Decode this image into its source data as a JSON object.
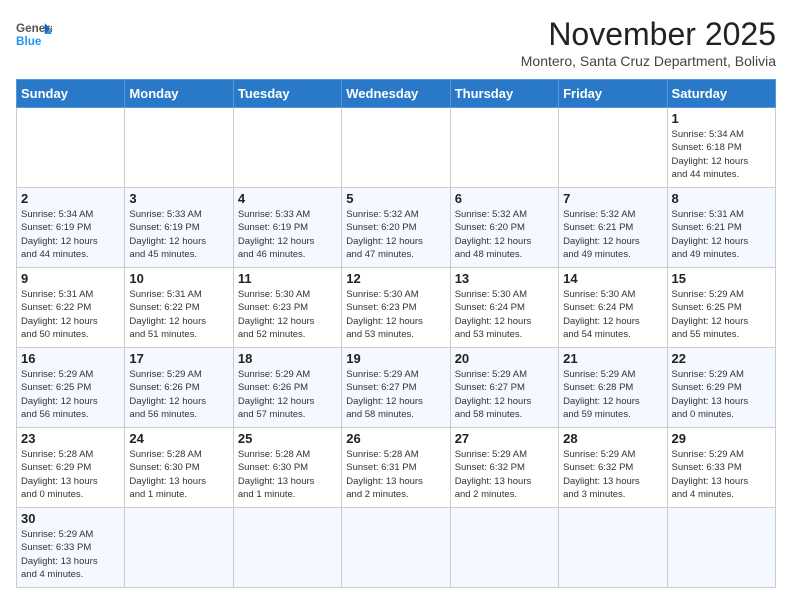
{
  "header": {
    "logo_general": "General",
    "logo_blue": "Blue",
    "month_title": "November 2025",
    "location": "Montero, Santa Cruz Department, Bolivia"
  },
  "weekdays": [
    "Sunday",
    "Monday",
    "Tuesday",
    "Wednesday",
    "Thursday",
    "Friday",
    "Saturday"
  ],
  "weeks": [
    [
      {
        "day": "",
        "info": ""
      },
      {
        "day": "",
        "info": ""
      },
      {
        "day": "",
        "info": ""
      },
      {
        "day": "",
        "info": ""
      },
      {
        "day": "",
        "info": ""
      },
      {
        "day": "",
        "info": ""
      },
      {
        "day": "1",
        "info": "Sunrise: 5:34 AM\nSunset: 6:18 PM\nDaylight: 12 hours\nand 44 minutes."
      }
    ],
    [
      {
        "day": "2",
        "info": "Sunrise: 5:34 AM\nSunset: 6:19 PM\nDaylight: 12 hours\nand 44 minutes."
      },
      {
        "day": "3",
        "info": "Sunrise: 5:33 AM\nSunset: 6:19 PM\nDaylight: 12 hours\nand 45 minutes."
      },
      {
        "day": "4",
        "info": "Sunrise: 5:33 AM\nSunset: 6:19 PM\nDaylight: 12 hours\nand 46 minutes."
      },
      {
        "day": "5",
        "info": "Sunrise: 5:32 AM\nSunset: 6:20 PM\nDaylight: 12 hours\nand 47 minutes."
      },
      {
        "day": "6",
        "info": "Sunrise: 5:32 AM\nSunset: 6:20 PM\nDaylight: 12 hours\nand 48 minutes."
      },
      {
        "day": "7",
        "info": "Sunrise: 5:32 AM\nSunset: 6:21 PM\nDaylight: 12 hours\nand 49 minutes."
      },
      {
        "day": "8",
        "info": "Sunrise: 5:31 AM\nSunset: 6:21 PM\nDaylight: 12 hours\nand 49 minutes."
      }
    ],
    [
      {
        "day": "9",
        "info": "Sunrise: 5:31 AM\nSunset: 6:22 PM\nDaylight: 12 hours\nand 50 minutes."
      },
      {
        "day": "10",
        "info": "Sunrise: 5:31 AM\nSunset: 6:22 PM\nDaylight: 12 hours\nand 51 minutes."
      },
      {
        "day": "11",
        "info": "Sunrise: 5:30 AM\nSunset: 6:23 PM\nDaylight: 12 hours\nand 52 minutes."
      },
      {
        "day": "12",
        "info": "Sunrise: 5:30 AM\nSunset: 6:23 PM\nDaylight: 12 hours\nand 53 minutes."
      },
      {
        "day": "13",
        "info": "Sunrise: 5:30 AM\nSunset: 6:24 PM\nDaylight: 12 hours\nand 53 minutes."
      },
      {
        "day": "14",
        "info": "Sunrise: 5:30 AM\nSunset: 6:24 PM\nDaylight: 12 hours\nand 54 minutes."
      },
      {
        "day": "15",
        "info": "Sunrise: 5:29 AM\nSunset: 6:25 PM\nDaylight: 12 hours\nand 55 minutes."
      }
    ],
    [
      {
        "day": "16",
        "info": "Sunrise: 5:29 AM\nSunset: 6:25 PM\nDaylight: 12 hours\nand 56 minutes."
      },
      {
        "day": "17",
        "info": "Sunrise: 5:29 AM\nSunset: 6:26 PM\nDaylight: 12 hours\nand 56 minutes."
      },
      {
        "day": "18",
        "info": "Sunrise: 5:29 AM\nSunset: 6:26 PM\nDaylight: 12 hours\nand 57 minutes."
      },
      {
        "day": "19",
        "info": "Sunrise: 5:29 AM\nSunset: 6:27 PM\nDaylight: 12 hours\nand 58 minutes."
      },
      {
        "day": "20",
        "info": "Sunrise: 5:29 AM\nSunset: 6:27 PM\nDaylight: 12 hours\nand 58 minutes."
      },
      {
        "day": "21",
        "info": "Sunrise: 5:29 AM\nSunset: 6:28 PM\nDaylight: 12 hours\nand 59 minutes."
      },
      {
        "day": "22",
        "info": "Sunrise: 5:29 AM\nSunset: 6:29 PM\nDaylight: 13 hours\nand 0 minutes."
      }
    ],
    [
      {
        "day": "23",
        "info": "Sunrise: 5:28 AM\nSunset: 6:29 PM\nDaylight: 13 hours\nand 0 minutes."
      },
      {
        "day": "24",
        "info": "Sunrise: 5:28 AM\nSunset: 6:30 PM\nDaylight: 13 hours\nand 1 minute."
      },
      {
        "day": "25",
        "info": "Sunrise: 5:28 AM\nSunset: 6:30 PM\nDaylight: 13 hours\nand 1 minute."
      },
      {
        "day": "26",
        "info": "Sunrise: 5:28 AM\nSunset: 6:31 PM\nDaylight: 13 hours\nand 2 minutes."
      },
      {
        "day": "27",
        "info": "Sunrise: 5:29 AM\nSunset: 6:32 PM\nDaylight: 13 hours\nand 2 minutes."
      },
      {
        "day": "28",
        "info": "Sunrise: 5:29 AM\nSunset: 6:32 PM\nDaylight: 13 hours\nand 3 minutes."
      },
      {
        "day": "29",
        "info": "Sunrise: 5:29 AM\nSunset: 6:33 PM\nDaylight: 13 hours\nand 4 minutes."
      }
    ],
    [
      {
        "day": "30",
        "info": "Sunrise: 5:29 AM\nSunset: 6:33 PM\nDaylight: 13 hours\nand 4 minutes."
      },
      {
        "day": "",
        "info": ""
      },
      {
        "day": "",
        "info": ""
      },
      {
        "day": "",
        "info": ""
      },
      {
        "day": "",
        "info": ""
      },
      {
        "day": "",
        "info": ""
      },
      {
        "day": "",
        "info": ""
      }
    ]
  ]
}
